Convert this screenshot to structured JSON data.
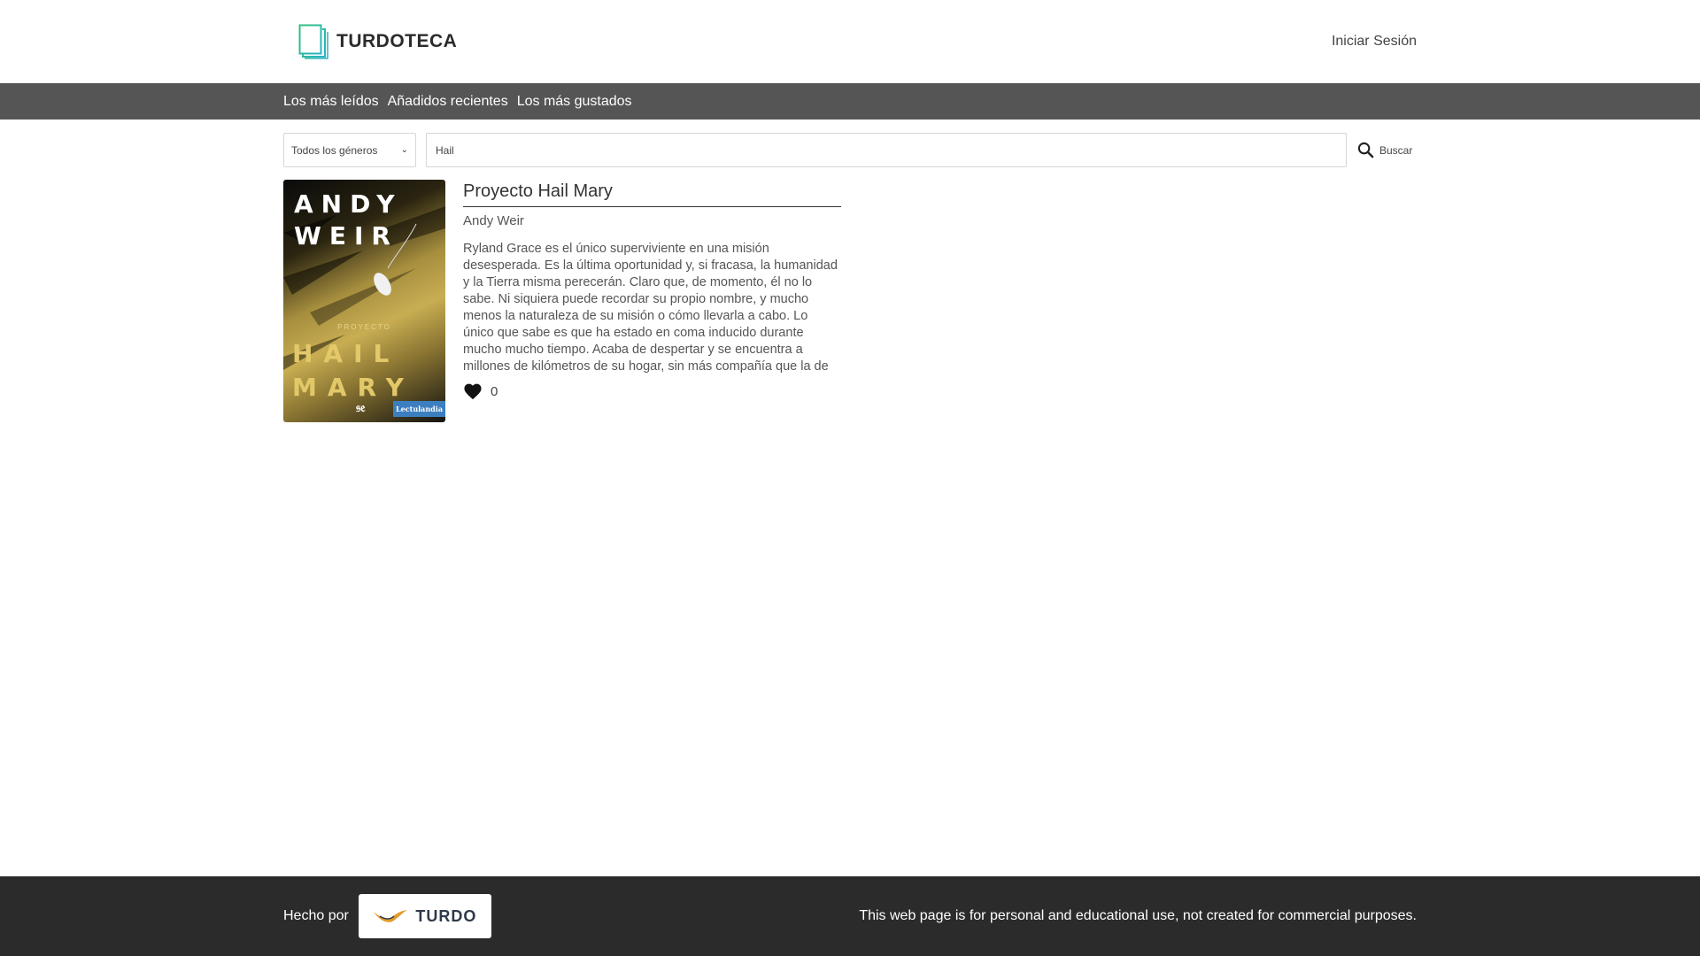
{
  "header": {
    "brand": "TURDOTECA",
    "login_label": "Iniciar Sesión"
  },
  "nav": {
    "items": [
      {
        "label": "Los más leídos"
      },
      {
        "label": "Añadidos recientes"
      },
      {
        "label": "Los más gustados"
      }
    ]
  },
  "search": {
    "genre_selected": "Todos los géneros",
    "query": "Hail",
    "button_label": "Buscar"
  },
  "results": [
    {
      "title": "Proyecto Hail Mary",
      "author": "Andy Weir",
      "description": "Ryland Grace es el único superviviente en una misión desesperada. Es la última oportunidad y, si fracasa, la humanidad y la Tierra misma perecerán. Claro que, de momento, él no lo sabe. Ni siquiera puede recordar su propio nombre, y mucho menos la naturaleza de su misión o cómo llevarla a cabo. Lo único que sabe es que ha estado en coma inducido durante mucho mucho tiempo. Acaba de despertar y se encuentra a millones de kilómetros de su hogar, sin más compañía que la de dos cadáveres.Muertos sus compañer…",
      "likes": "0",
      "cover": {
        "author_line1": "ANDY",
        "author_line2": "WEIR",
        "subtitle": "PROYECTO",
        "title_line1": "HAIL",
        "title_line2": "MARY",
        "publisher_mark": "𝔰𝔢",
        "publisher_badge": "Lectulandia"
      }
    }
  ],
  "footer": {
    "made_by_label": "Hecho por",
    "badge_text": "TURDO",
    "disclaimer": "This web page is for personal and educational use, not created for commercial purposes."
  }
}
